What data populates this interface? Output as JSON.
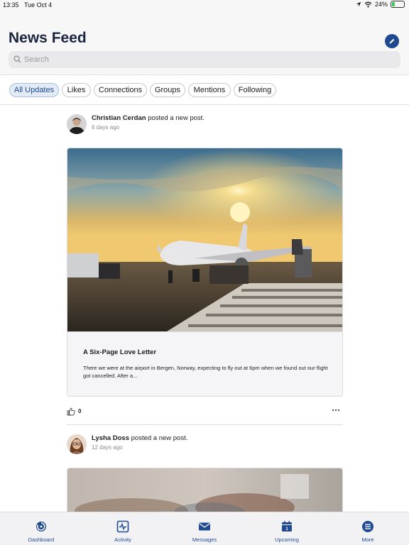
{
  "status_bar": {
    "time": "13:35",
    "date": "Tue Oct 4",
    "battery": "24%"
  },
  "header": {
    "title": "News Feed",
    "search_placeholder": "Search"
  },
  "filters": [
    "All Updates",
    "Likes",
    "Connections",
    "Groups",
    "Mentions",
    "Following"
  ],
  "active_filter": "All Updates",
  "posts": [
    {
      "author": "Christian Cerdan",
      "action": "posted a new post.",
      "time": "6 days ago",
      "title": "A Six-Page Love Letter",
      "excerpt": "There we were at the airport in Bergen, Norway, expecting to fly out at 6pm when we found out our flight got cancelled. After a...",
      "likes": "0"
    },
    {
      "author": "Lysha Doss",
      "action": "posted a new post.",
      "time": "12 days ago"
    }
  ],
  "tabbar": [
    {
      "label": "Dashboard",
      "icon": "dashboard-icon"
    },
    {
      "label": "Activity",
      "icon": "activity-icon"
    },
    {
      "label": "Messages",
      "icon": "envelope-icon"
    },
    {
      "label": "Upcoming",
      "icon": "calendar-icon"
    },
    {
      "label": "More",
      "icon": "list-icon"
    }
  ],
  "colors": {
    "accent": "#1f4a8f",
    "battery": "#34c759",
    "active_chip_bg": "#e3ebf6"
  }
}
